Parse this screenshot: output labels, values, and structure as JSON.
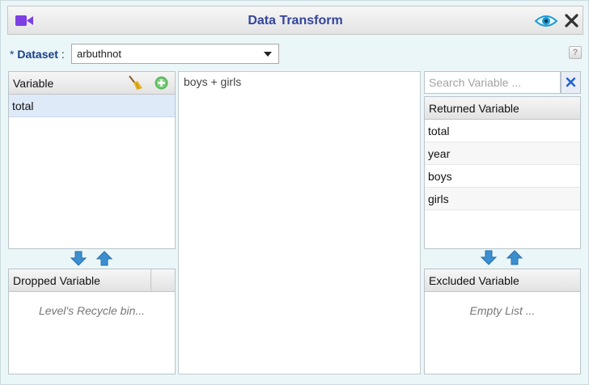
{
  "header": {
    "title": "Data Transform",
    "icons": [
      "video-icon",
      "eye-icon",
      "close-icon"
    ],
    "accent_color": "#7b3fe4",
    "title_color": "#34459a"
  },
  "dataset": {
    "required_mark": "*",
    "label": "Dataset",
    "separator": ":",
    "value": "arbuthnot",
    "help_glyph": "?"
  },
  "variable_panel": {
    "header": "Variable",
    "items": [
      {
        "label": "total",
        "selected": true
      }
    ]
  },
  "dropped_panel": {
    "header": "Dropped Variable",
    "empty_text": "Level's Recycle bin..."
  },
  "formula": {
    "text": "boys + girls"
  },
  "search": {
    "placeholder": "Search Variable ..."
  },
  "returned_panel": {
    "header": "Returned Variable",
    "items": [
      "total",
      "year",
      "boys",
      "girls"
    ]
  },
  "excluded_panel": {
    "header": "Excluded Variable",
    "empty_text": "Empty List ..."
  }
}
